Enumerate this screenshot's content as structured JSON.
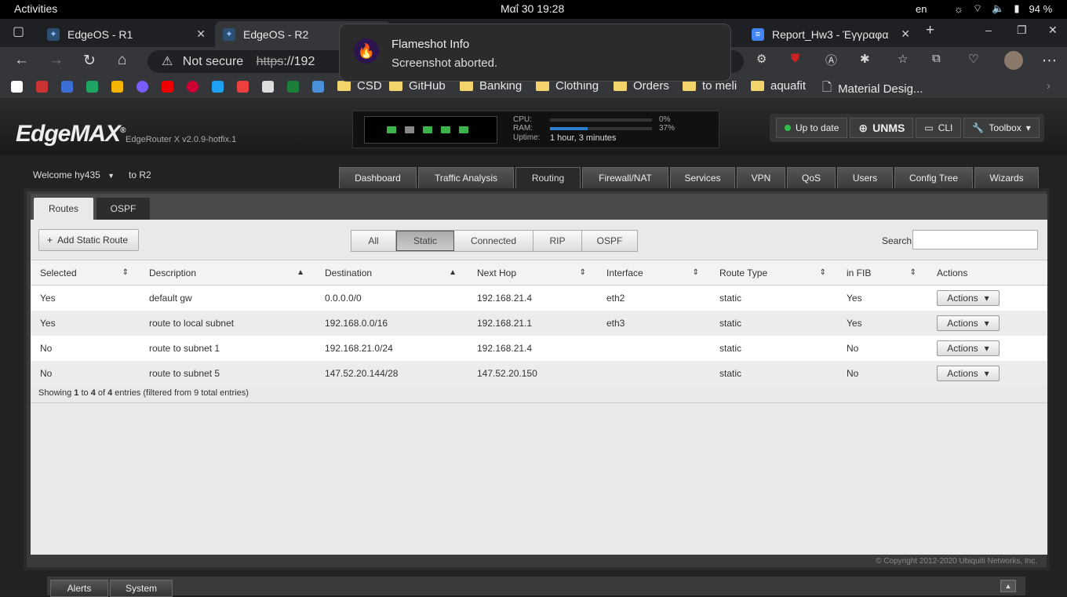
{
  "system": {
    "activities": "Activities",
    "clock": "Μαΐ 30  19:28",
    "lang": "en",
    "battery": "94 %"
  },
  "browser": {
    "tabs": [
      {
        "title": "EdgeOS - R1"
      },
      {
        "title": "EdgeOS - R2"
      },
      {
        "title": "Report_Hw3 - Έγγραφα"
      }
    ],
    "not_secure": "Not secure",
    "url_scheme": "https",
    "url_rest": "://192",
    "bookmarks": [
      "CSD",
      "GitHub",
      "Banking",
      "Clothing",
      "Orders",
      "to meli",
      "aquafit",
      "Material Desig..."
    ]
  },
  "toast": {
    "title": "Flameshot Info",
    "message": "Screenshot aborted."
  },
  "app": {
    "logo": "EdgeMAX",
    "model": "EdgeRouter X v2.0.9-hotfix.1",
    "cpu_label": "CPU:",
    "ram_label": "RAM:",
    "uptime_label": "Uptime:",
    "cpu": "0%",
    "ram": "37%",
    "cpu_value": 0,
    "ram_value": 0.37,
    "uptime": "1 hour, 3 minutes",
    "status": "Up to date",
    "unms": "UNMS",
    "cli": "CLI",
    "toolbox": "Toolbox",
    "welcome": "Welcome hy435",
    "to": "to R2",
    "main_tabs": [
      "Dashboard",
      "Traffic Analysis",
      "Routing",
      "Firewall/NAT",
      "Services",
      "VPN",
      "QoS",
      "Users",
      "Config Tree",
      "Wizards"
    ],
    "sub_tabs": [
      "Routes",
      "OSPF"
    ],
    "add_static_route": "Add Static Route",
    "filters": [
      "All",
      "Static",
      "Connected",
      "RIP",
      "OSPF"
    ],
    "search_label": "Search",
    "columns": [
      "Selected",
      "Description",
      "Destination",
      "Next Hop",
      "Interface",
      "Route Type",
      "in FIB",
      "Actions"
    ],
    "rows": [
      [
        "Yes",
        "default gw",
        "0.0.0.0/0",
        "192.168.21.4",
        "eth2",
        "static",
        "Yes",
        "Actions"
      ],
      [
        "Yes",
        "route to local subnet",
        "192.168.0.0/16",
        "192.168.21.1",
        "eth3",
        "static",
        "Yes",
        "Actions"
      ],
      [
        "No",
        "route to subnet 1",
        "192.168.21.0/24",
        "192.168.21.4",
        "",
        "static",
        "No",
        "Actions"
      ],
      [
        "No",
        "route to subnet 5",
        "147.52.20.144/28",
        "147.52.20.150",
        "",
        "static",
        "No",
        "Actions"
      ]
    ],
    "showing": {
      "prefix": "Showing ",
      "from": "1",
      "to_word": " to ",
      "to": "4",
      "of_word": " of ",
      "total": "4",
      "suffix": " entries (filtered from 9 total entries)"
    },
    "copyright": "© Copyright 2012-2020 Ubiquiti Networks, Inc.",
    "bottom_tabs": [
      "Alerts",
      "System"
    ]
  }
}
